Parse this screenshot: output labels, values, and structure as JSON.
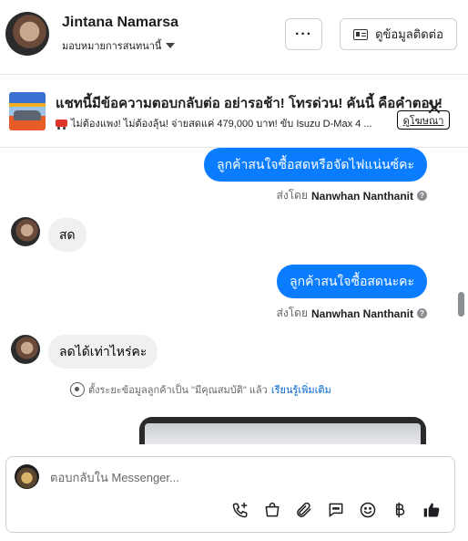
{
  "header": {
    "contact_name": "Jintana Namarsa",
    "assign_label": "มอบหมายการสนทนานี้",
    "more_label": "···",
    "view_contact_label": "ดูข้อมูลติดต่อ"
  },
  "ad": {
    "title": "แชทนี้มีข้อความตอบกลับต่อ อย่ารอช้า! โทรด่วน! คันนี้ คือคำตอบ!",
    "description": "ไม่ต้องแพง! ไม่ต้องลุ้น! จ่ายสดแค่ 479,000 บาท! ขับ Isuzu D-Max 4 ...",
    "view_ad_label": "ดูโฆษณา"
  },
  "messages": [
    {
      "direction": "out",
      "text": "ลูกค้าสนใจซื้อสดหรือจัดไฟแน่นซ์คะ",
      "sent_by_prefix": "ส่งโดย",
      "sent_by_name": "Nanwhan Nanthanit"
    },
    {
      "direction": "in",
      "text": "สด"
    },
    {
      "direction": "out",
      "text": "ลูกค้าสนใจซื้อสดนะคะ",
      "sent_by_prefix": "ส่งโดย",
      "sent_by_name": "Nanwhan Nanthanit"
    },
    {
      "direction": "in",
      "text": "ลดได้เท่าไหร่คะ"
    }
  ],
  "system_note": {
    "text": "ตั้งระยะข้อมูลลูกค้าเป็น \"มีคุณสมบัติ\" แล้ว",
    "link": "เรียนรู้เพิ่มเติม"
  },
  "composer": {
    "placeholder": "ตอบกลับใน Messenger...",
    "tools": [
      "phone-plus-icon",
      "shopping-bag-icon",
      "paperclip-icon",
      "chat-template-icon",
      "emoji-icon",
      "baht-icon",
      "like-icon"
    ]
  },
  "colors": {
    "accent": "#0a7cff",
    "incoming_bubble": "#f0f0f0",
    "link": "#0064d1"
  }
}
